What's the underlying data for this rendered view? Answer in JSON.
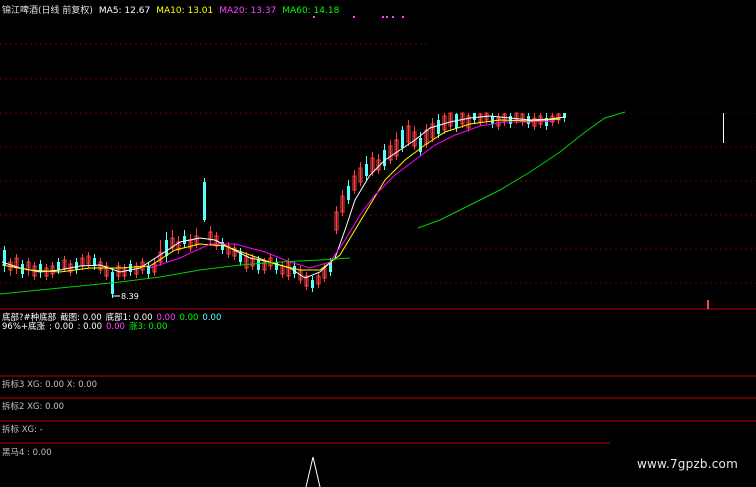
{
  "header": {
    "stock_name": "锦江啤酒(日线 前复权)",
    "ma5": "MA5: 12.67",
    "ma10": "MA10: 13.01",
    "ma20": "MA20: 13.37",
    "ma60": "MA60: 14.18"
  },
  "price_annotation": "8.39",
  "indicator_row1": {
    "name": "底部?#种底部",
    "v1": "截图: 0.00",
    "v2": "底部1: 0.00",
    "v3": "0.00",
    "v4": "0.00",
    "v5": "0.00"
  },
  "indicator_row2": {
    "name": "96%+底涨",
    "v1": ": 0.00",
    "v2": ": 0.00",
    "v3": "0.00",
    "v4": "涨3: 0.00"
  },
  "panels": [
    {
      "text": "拆标3 XG: 0.00 X: 0.00"
    },
    {
      "text": "拆标2 XG: 0.00"
    },
    {
      "text": "拆标 XG: -"
    },
    {
      "text": "黑马4 : 0.00"
    }
  ],
  "watermark": "www.7gpzb.com",
  "colors": {
    "up": "#ff4040",
    "down": "#54ffff",
    "ma5": "#ffffff",
    "ma10": "#ffff00",
    "ma20": "#ff00ff",
    "ma60": "#00ff00",
    "grid": "#8b0000"
  },
  "candles_summary": "rise from low 8.39 then rally"
}
